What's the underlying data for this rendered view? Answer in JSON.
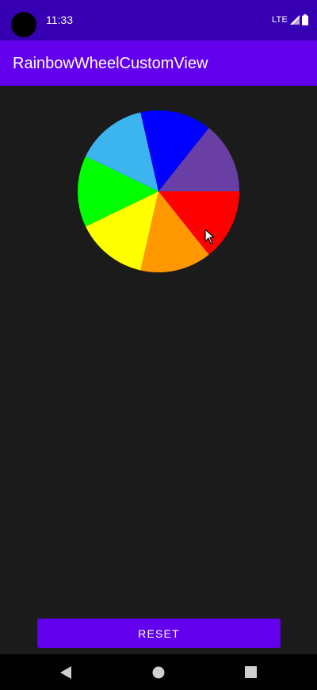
{
  "status_bar": {
    "time": "11:33",
    "network": "LTE",
    "signal_icon": "signal-icon",
    "battery_icon": "battery-icon"
  },
  "app_bar": {
    "title": "RainbowWheelCustomView"
  },
  "wheel": {
    "colors": [
      "#ff0000",
      "#ff9800",
      "#ffff00",
      "#00ff00",
      "#3cb4f0",
      "#0000ff",
      "#6a3fa5"
    ]
  },
  "actions": {
    "reset_label": "RESET"
  },
  "navigation": {
    "back_icon": "back-triangle-icon",
    "home_icon": "home-circle-icon",
    "recents_icon": "recents-square-icon"
  },
  "colors": {
    "status_bar": "#3700b3",
    "app_bar": "#6200ee",
    "background": "#1b1b1b",
    "button": "#6200ee"
  }
}
